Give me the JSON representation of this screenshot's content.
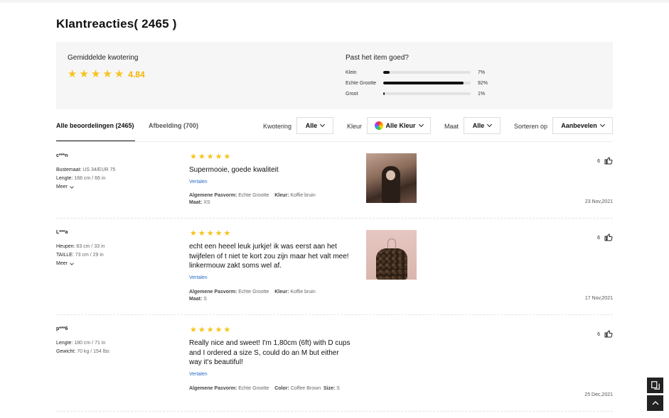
{
  "page": {
    "title": "Klantreacties( 2465 )"
  },
  "summary": {
    "avg_label": "Gemiddelde kwotering",
    "avg_value": "4.84",
    "avg_stars": 5,
    "fit_label": "Past het item goed?",
    "fit_rows": [
      {
        "name": "Klein",
        "pct": "7%",
        "fraction": 0.07
      },
      {
        "name": "Echte Grootte",
        "pct": "92%",
        "fraction": 0.92
      },
      {
        "name": "Groot",
        "pct": "1%",
        "fraction": 0.01
      }
    ]
  },
  "tabs": {
    "all": "Alle beoordelingen (2465)",
    "images": "Afbeelding (700)"
  },
  "filters": {
    "rating_label": "Kwotering",
    "rating_value": "Alle",
    "color_label": "Kleur",
    "color_value": "Alle Kleur",
    "size_label": "Maat",
    "size_value": "Alle",
    "sort_label": "Sorteren op",
    "sort_value": "Aanbevelen"
  },
  "reviews": [
    {
      "user": "c***n",
      "measurements": [
        {
          "label": "Bustemaat:",
          "value": "US 34/EUR 75"
        },
        {
          "label": "Lengte:",
          "value": "168 cm / 66 in"
        }
      ],
      "more": "Meer",
      "stars": 5,
      "text": "Supermooie, goede kwaliteit",
      "translate": "Vertalen",
      "fit_label": "Algemene Pasvorm:",
      "fit_value": "Echte Grootte",
      "color_label": "Kleur:",
      "color_value": "Koffie bruin",
      "size_label": "Maat:",
      "size_value": "XS",
      "likes": "6",
      "date": "23 Nov,2021"
    },
    {
      "user": "L***a",
      "measurements": [
        {
          "label": "Heupen:",
          "value": "83 cm / 33 in"
        },
        {
          "label": "TAILLE:",
          "value": "73 cm / 29 in"
        }
      ],
      "more": "Meer",
      "stars": 5,
      "text": "echt een heeel leuk jurkje! ik was eerst aan het twijfelen of t niet te kort zou zijn maar het valt mee! linkermouw zakt soms wel af.",
      "translate": "Vertalen",
      "fit_label": "Algemene Pasvorm:",
      "fit_value": "Echte Grootte",
      "color_label": "Kleur:",
      "color_value": "Koffie bruin",
      "size_label": "Maat:",
      "size_value": "S",
      "likes": "6",
      "date": "17 Nov,2021"
    },
    {
      "user": "p***6",
      "measurements": [
        {
          "label": "Lengte:",
          "value": "180 cm / 71 in"
        },
        {
          "label": "Gewicht:",
          "value": "70 kg / 154 lbs"
        }
      ],
      "stars": 5,
      "text": "Really nice and sweet! I'm 1,80cm (6ft) with D cups and I ordered a size S, could do an M but either way it's beautiful!",
      "translate": "Vertalen",
      "fit_label": "Algemene Pasvorm:",
      "fit_value": "Echte Grootte",
      "color_label": "Color:",
      "color_value": "Coffee Brown",
      "size_label": "Size:",
      "size_value": "S",
      "likes": "6",
      "date": "25 Dec,2021"
    }
  ],
  "colors": {
    "star": "#f7c21b",
    "avg_value": "#f7b500",
    "link": "#2b6bc5",
    "bar_fill": "#111111",
    "bar_track": "#e2e2e2"
  }
}
